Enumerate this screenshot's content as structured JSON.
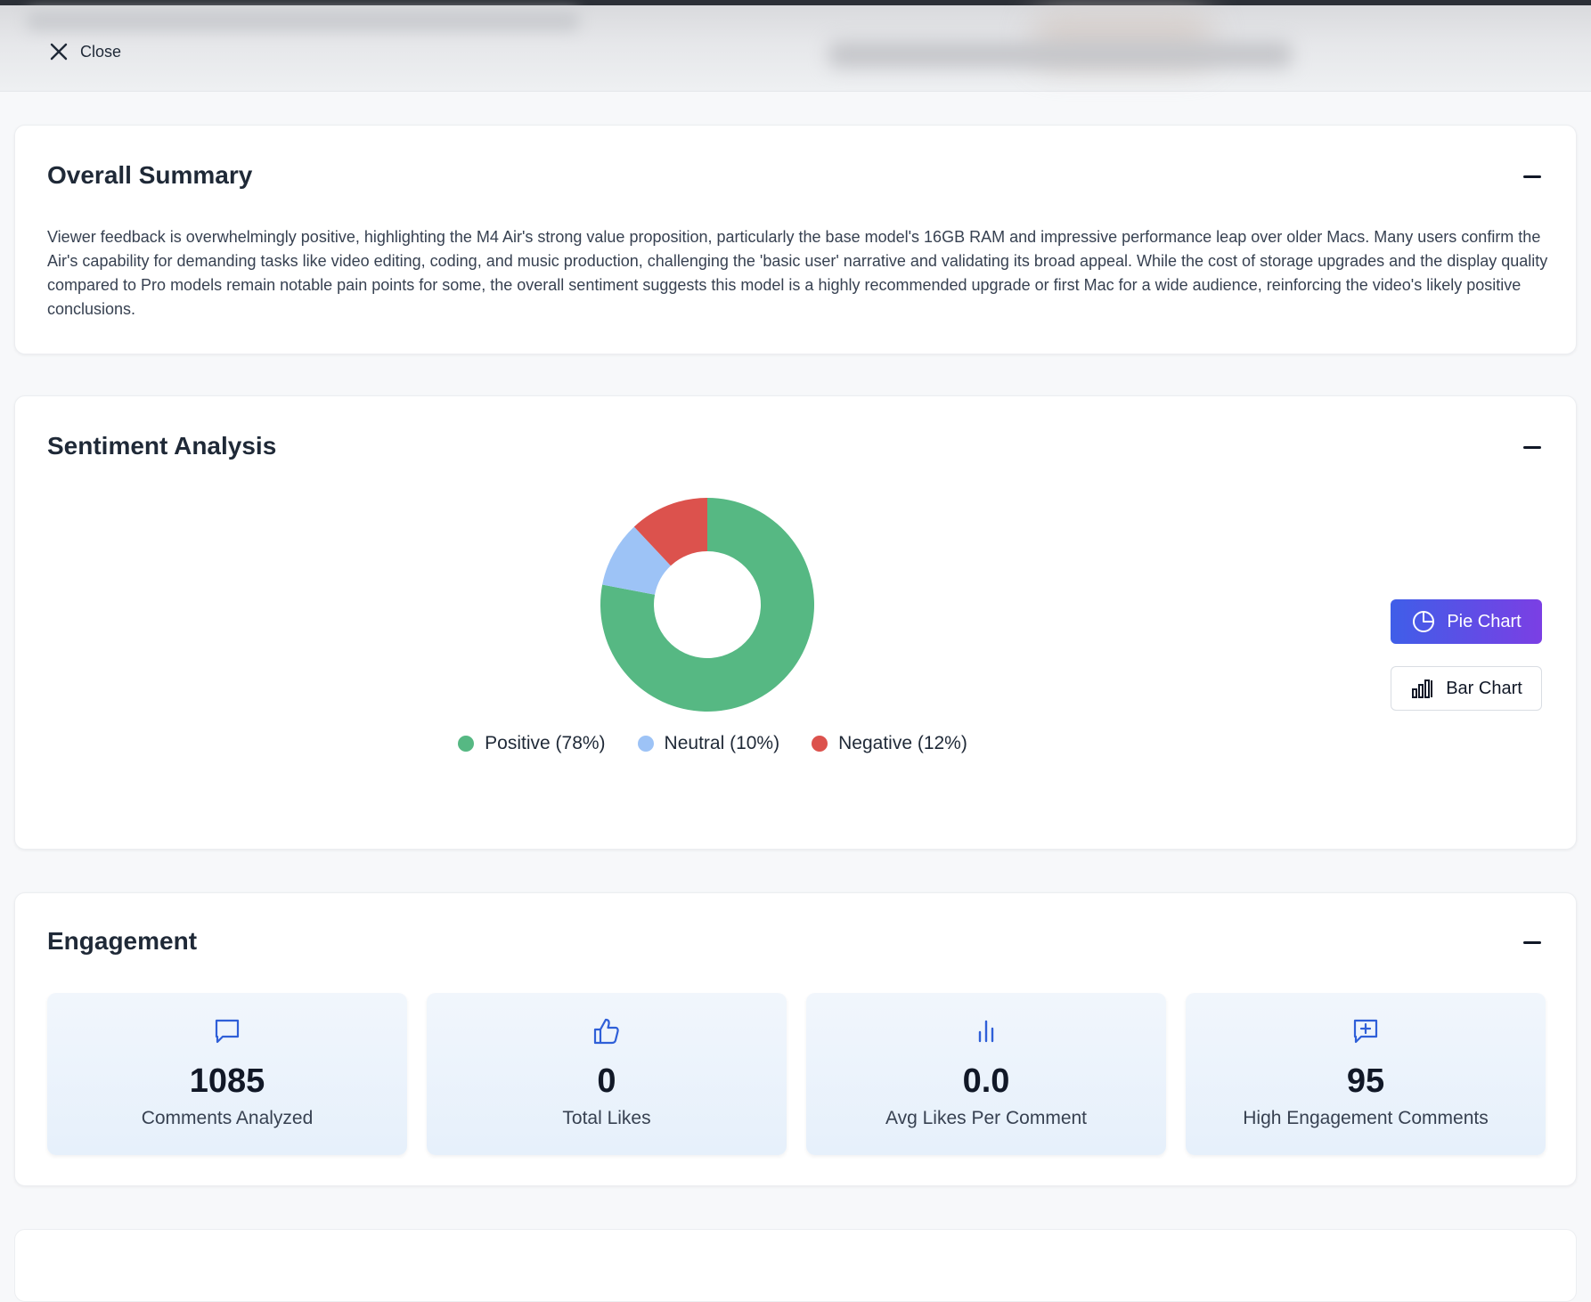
{
  "header": {
    "close_label": "Close"
  },
  "summary": {
    "title": "Overall Summary",
    "text": "Viewer feedback is overwhelmingly positive, highlighting the M4 Air's strong value proposition, particularly the base model's 16GB RAM and impressive performance leap over older Macs. Many users confirm the Air's capability for demanding tasks like video editing, coding, and music production, challenging the 'basic user' narrative and validating its broad appeal. While the cost of storage upgrades and the display quality compared to Pro models remain notable pain points for some, the overall sentiment suggests this model is a highly recommended upgrade or first Mac for a wide audience, reinforcing the video's likely positive conclusions."
  },
  "sentiment": {
    "title": "Sentiment Analysis",
    "pie_button": "Pie Chart",
    "bar_button": "Bar Chart",
    "legend": [
      {
        "label": "Positive (78%)",
        "color": "#56b883"
      },
      {
        "label": "Neutral (10%)",
        "color": "#9dc3f6"
      },
      {
        "label": "Negative (12%)",
        "color": "#dc524d"
      }
    ]
  },
  "chart_data": {
    "type": "pie",
    "donut": true,
    "title": "",
    "categories": [
      "Positive (78%)",
      "Neutral (10%)",
      "Negative (12%)"
    ],
    "values": [
      78,
      10,
      12
    ],
    "colors": [
      "#56b883",
      "#9dc3f6",
      "#dc524d"
    ],
    "legend_position": "bottom"
  },
  "engagement": {
    "title": "Engagement",
    "tiles": [
      {
        "icon": "comment-icon",
        "value": "1085",
        "label": "Comments Analyzed"
      },
      {
        "icon": "thumbs-up-icon",
        "value": "0",
        "label": "Total Likes"
      },
      {
        "icon": "bar-chart-icon",
        "value": "0.0",
        "label": "Avg Likes Per Comment"
      },
      {
        "icon": "message-plus-icon",
        "value": "95",
        "label": "High Engagement Comments"
      }
    ]
  },
  "colors": {
    "accent_start": "#3f5ee8",
    "accent_end": "#7b3fe4",
    "icon_blue": "#2f5fd8"
  }
}
